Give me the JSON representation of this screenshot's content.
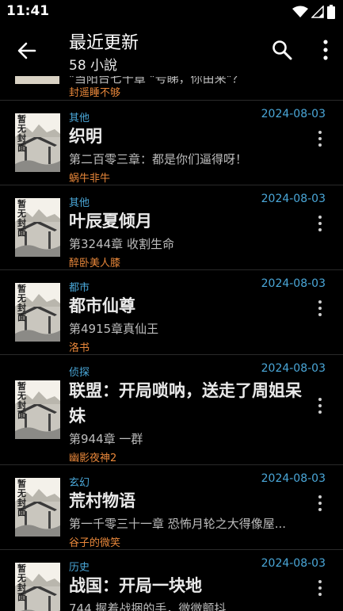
{
  "status_bar": {
    "time": "11:41"
  },
  "appbar": {
    "title": "最近更新",
    "subtitle": "58 小說"
  },
  "cover_text": "暂无封面",
  "partial_item": {
    "latest": "\"当阳台七十章 \"号睇，你由来\"？",
    "author": "封遥睡不够"
  },
  "books": [
    {
      "category": "其他",
      "date": "2024-08-03",
      "title": "织明",
      "latest": "第二百零三章：都是你们逼得呀！",
      "author": "蜗牛非牛"
    },
    {
      "category": "其他",
      "date": "2024-08-03",
      "title": "叶辰夏倾月",
      "latest": "第3244章 收割生命",
      "author": "醉卧美人膝"
    },
    {
      "category": "都市",
      "date": "2024-08-03",
      "title": "都市仙尊",
      "latest": "第4915章真仙王",
      "author": "洛书"
    },
    {
      "category": "侦探",
      "date": "2024-08-03",
      "title": "联盟：开局唢呐，送走了周姐呆妹",
      "latest": "第944章 一群",
      "author": "幽影夜神2"
    },
    {
      "category": "玄幻",
      "date": "2024-08-03",
      "title": "荒村物语",
      "latest": "第一千零三十一章 恐怖月轮之大得像屋...",
      "author": "谷子的微笑"
    },
    {
      "category": "历史",
      "date": "2024-08-03",
      "title": "战国：开局一块地",
      "latest": "744 握着战捆的手，微微颤抖",
      "author": ""
    }
  ],
  "colors": {
    "category": "#4aa7d8",
    "author": "#e8873a",
    "background": "#000000",
    "divider": "#2a2a2a"
  }
}
